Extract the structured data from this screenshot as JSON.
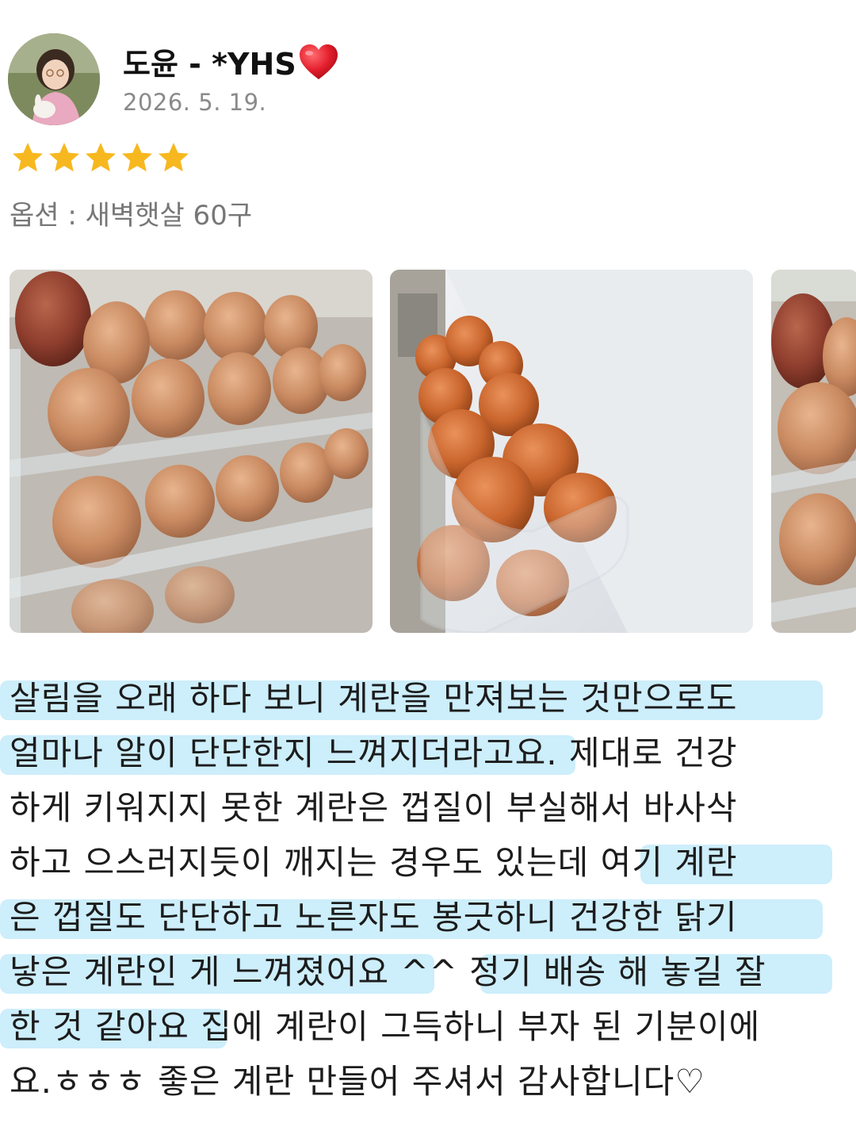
{
  "review": {
    "username": "도윤 - *YHS",
    "date": "2026. 5. 19.",
    "rating": 5,
    "rating_max": 5,
    "option_text": "옵션 : 새벽햇살 60구",
    "photos": [
      {
        "alt": "egg-tray-door"
      },
      {
        "alt": "egg-tray-shelf"
      },
      {
        "alt": "egg-tray-partial"
      }
    ],
    "body_lines": [
      "살림을 오래 하다 보니 계란을 만져보는 것만으로도",
      "얼마나 알이 단단한지 느껴지더라고요. 제대로 건강",
      "하게 키워지지 못한 계란은 껍질이 부실해서 바사삭",
      "하고 으스러지듯이 깨지는 경우도 있는데 여기 계란",
      "은 껍질도 단단하고 노른자도 봉긋하니 건강한 닭기",
      "낳은 계란인 게 느껴졌어요 ^^ 정기 배송 해 놓길 잘",
      "한 것 같아요 집에 계란이 그득하니 부자 된 기분이에",
      "요.ㅎㅎㅎ 좋은 계란 만들어 주셔서 감사합니다♡"
    ]
  },
  "colors": {
    "highlight": "#cdeefb",
    "star": "#f7b81f",
    "heart": "#e21d2b",
    "muted": "#8a8a8a"
  },
  "icons": {
    "heart": "heart-icon",
    "star": "star-icon"
  }
}
